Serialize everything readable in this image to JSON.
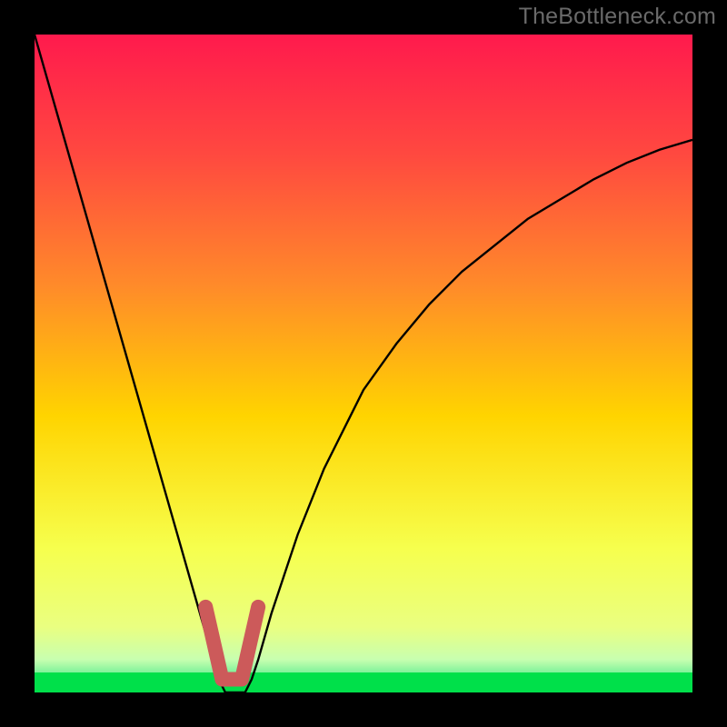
{
  "watermark": "TheBottleneck.com",
  "chart_data": {
    "type": "line",
    "title": "",
    "xlabel": "",
    "ylabel": "",
    "xlim": [
      0,
      100
    ],
    "ylim": [
      0,
      100
    ],
    "background_gradient": {
      "top": "#ff1a4d",
      "mid_upper": "#ff6a33",
      "mid": "#ffd400",
      "mid_lower": "#f6ff4d",
      "green_band": "#00e04a",
      "bottom": "#00ff55"
    },
    "series": [
      {
        "name": "curve",
        "stroke": "#000000",
        "x": [
          0,
          2,
          4,
          6,
          8,
          10,
          12,
          14,
          16,
          18,
          20,
          22,
          24,
          26,
          27,
          28,
          29,
          30,
          31,
          32,
          33,
          34,
          36,
          38,
          40,
          42,
          44,
          46,
          48,
          50,
          55,
          60,
          65,
          70,
          75,
          80,
          85,
          90,
          95,
          100
        ],
        "y": [
          100,
          93,
          86,
          79,
          72,
          65,
          58,
          51,
          44,
          37,
          30,
          23,
          16,
          9,
          5,
          2,
          0,
          0,
          0,
          0,
          2,
          5,
          12,
          18,
          24,
          29,
          34,
          38,
          42,
          46,
          53,
          59,
          64,
          68,
          72,
          75,
          78,
          80.5,
          82.5,
          84
        ]
      },
      {
        "name": "trough-marker",
        "type": "shape",
        "stroke": "#cc5a5a",
        "fill": "none",
        "stroke_width": 8,
        "description": "V-shaped thick coral marker near the curve minimum",
        "polyline": [
          {
            "x": 26,
            "y": 13
          },
          {
            "x": 28.5,
            "y": 2
          },
          {
            "x": 31.5,
            "y": 2
          },
          {
            "x": 34,
            "y": 13
          }
        ]
      }
    ],
    "annotations": [
      {
        "type": "band",
        "name": "green-band",
        "y_from": 0,
        "y_to": 3,
        "color": "#00e04a"
      }
    ]
  }
}
